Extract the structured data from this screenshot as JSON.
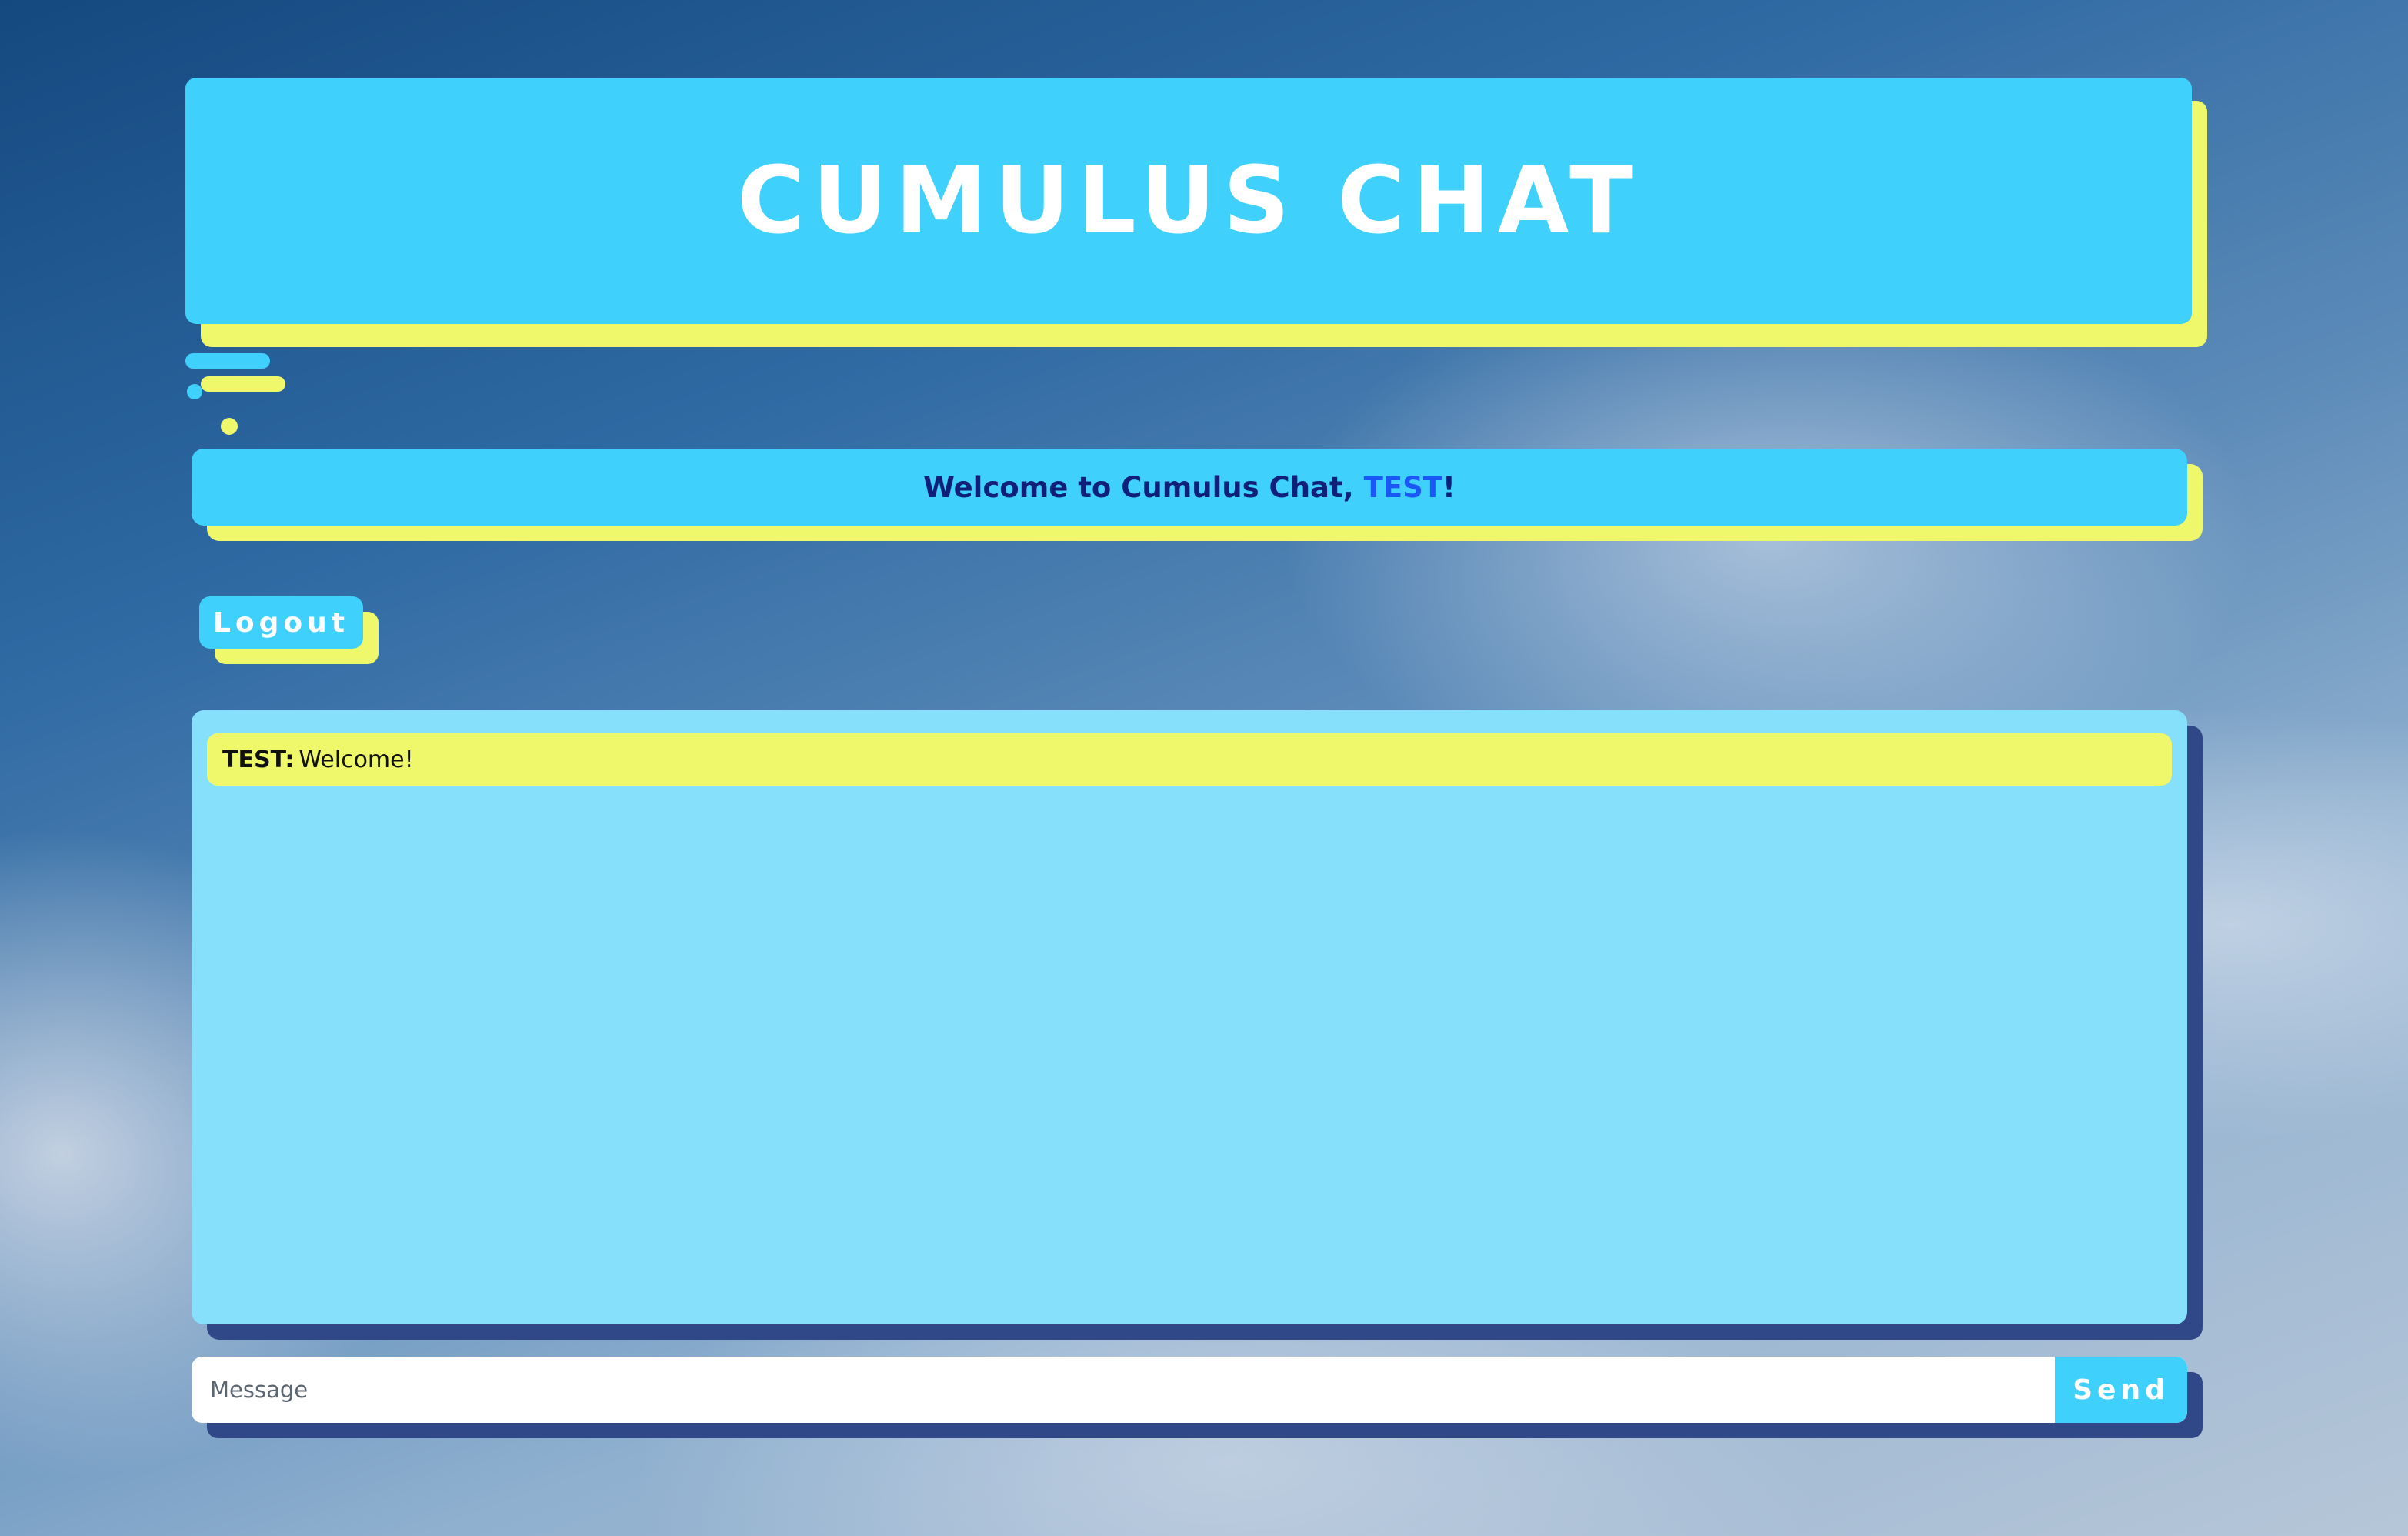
{
  "header": {
    "title": "CUMULUS CHAT"
  },
  "welcome": {
    "prefix": "Welcome to Cumulus Chat, ",
    "username": "TEST",
    "suffix": "!"
  },
  "actions": {
    "logout_label": "Logout"
  },
  "chat": {
    "messages": [
      {
        "author": "TEST:",
        "text": "Welcome!"
      }
    ]
  },
  "composer": {
    "placeholder": "Message",
    "value": "",
    "send_label": "Send"
  },
  "colors": {
    "accent_cyan": "#3fd0fb",
    "accent_yellow": "#eff86a",
    "shadow_navy": "#314888",
    "chat_background": "#86dffb",
    "username_blue": "#1a57f5",
    "welcome_text": "#10207a"
  }
}
